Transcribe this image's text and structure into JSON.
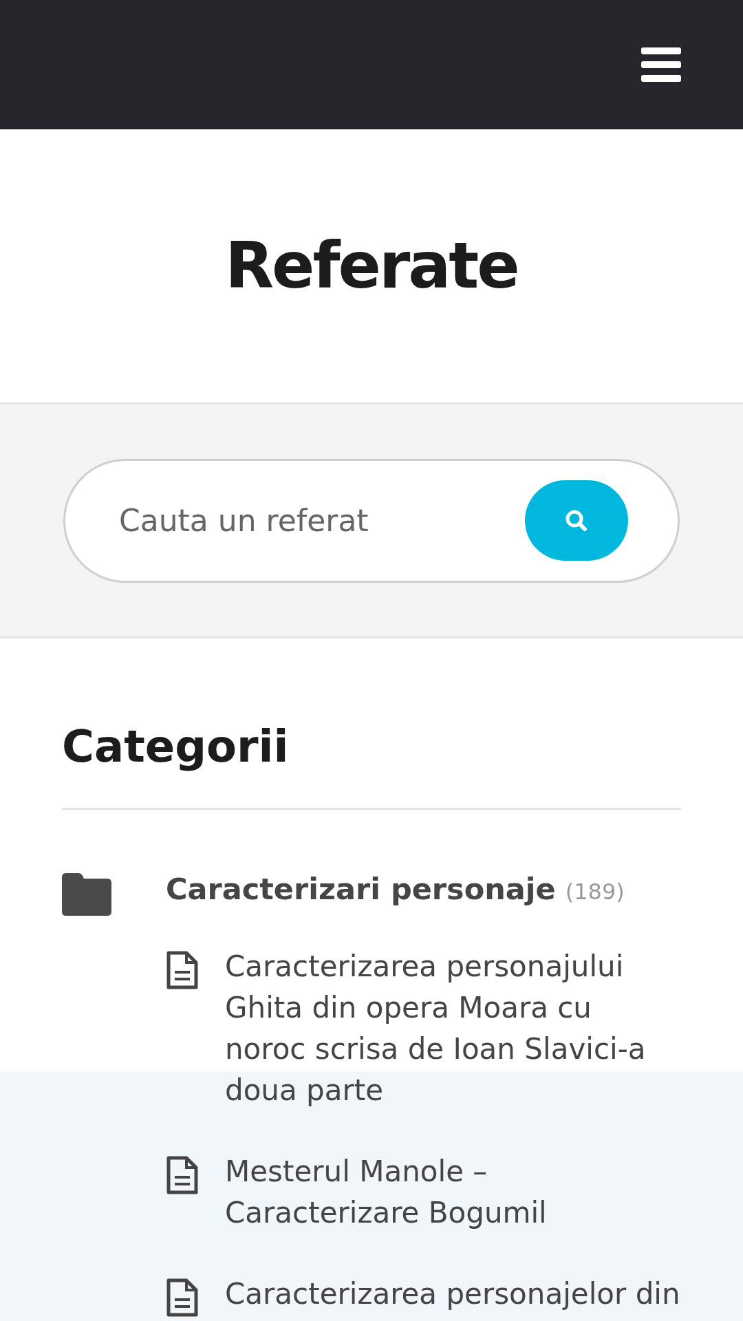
{
  "title": "Referate",
  "search": {
    "placeholder": "Cauta un referat"
  },
  "categories_heading": "Categorii",
  "categories": [
    {
      "name": "Caracterizari personaje",
      "count": "(189)",
      "items": [
        "Caracterizarea personajului Ghita din opera Moara cu noroc scrisa de Ioan Slavici-a doua parte",
        "Mesterul Manole – Caracterizare Bogumil",
        "Caracterizarea personajelor din"
      ]
    }
  ]
}
